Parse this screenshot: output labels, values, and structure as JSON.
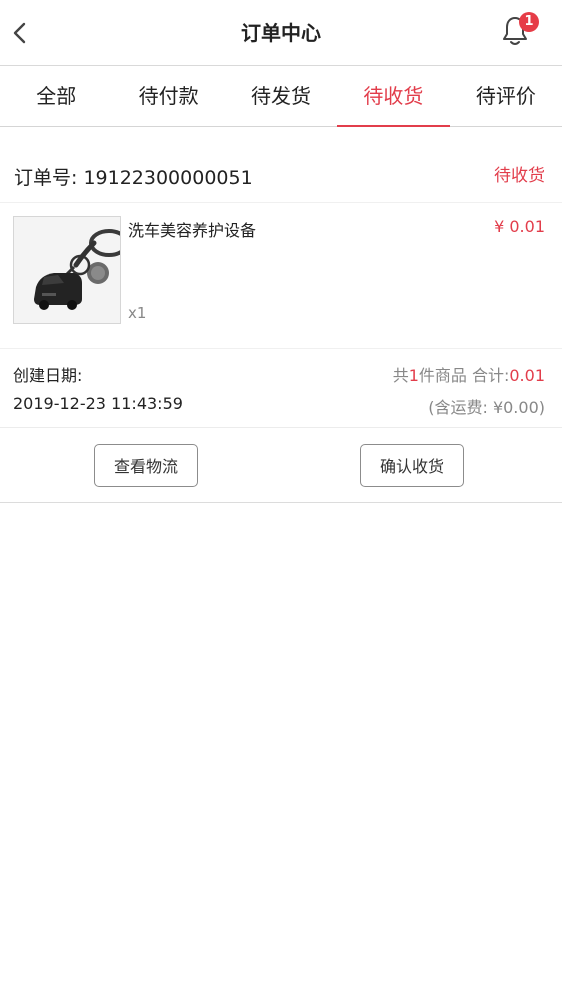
{
  "header": {
    "title": "订单中心",
    "notification_count": "1"
  },
  "tabs": [
    {
      "label": "全部",
      "active": false
    },
    {
      "label": "待付款",
      "active": false
    },
    {
      "label": "待发货",
      "active": false
    },
    {
      "label": "待收货",
      "active": true
    },
    {
      "label": "待评价",
      "active": false
    }
  ],
  "order": {
    "order_no": "订单号: 19122300000051",
    "status": "待收货",
    "product": {
      "name": "洗车美容养护设备",
      "price": "¥ 0.01",
      "qty": "x1"
    },
    "meta": {
      "create_label": "创建日期:",
      "create_date": "2019-12-23 11:43:59",
      "summary_prefix": "共",
      "summary_count": "1",
      "summary_middle": "件商品 合计:",
      "summary_total": "0.01",
      "shipping": "(含运费: ¥0.00)"
    },
    "actions": {
      "logistics": "查看物流",
      "confirm": "确认收货"
    }
  },
  "icons": {
    "back": "chevron-left-icon",
    "bell": "bell-icon"
  },
  "colors": {
    "accent": "#e23d4b",
    "badge": "#e63c47",
    "muted": "#888888"
  }
}
